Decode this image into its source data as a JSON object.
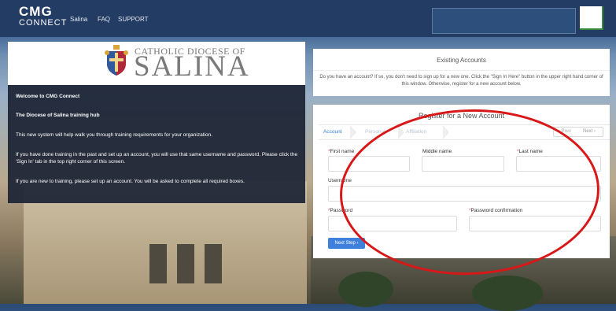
{
  "app": {
    "logo_line1": "CMG",
    "logo_line2": "CONNECT",
    "nav": [
      "Salina",
      "FAQ",
      "SUPPORT"
    ]
  },
  "diocese": {
    "line1": "CATHOLIC DIOCESE OF",
    "line2": "SALINA"
  },
  "welcome": {
    "title": "Welcome to CMG Connect",
    "hub": "The Diocese of Salina training hub",
    "p1": "This new system will help walk you through training requirements for your organization.",
    "p2": "If you have done training in the past and set up an account, you will use that same username and password.  Please click the 'Sign In' tab in the top right corner of this screen.",
    "p3": "If you are new to training, please set up an account.  You will be asked to complete all required boxes."
  },
  "existing": {
    "title": "Existing Accounts",
    "body": "Do you have an account? If so, you don't need to sign up for a new one. Click the \"Sign In Here\" button in the upper right hand corner of this window. Otherwise, register for a new account below."
  },
  "register": {
    "title": "Register for a New Account",
    "steps": [
      "Account",
      "Personal",
      "Affiliation"
    ],
    "pager_prev": "‹ Prev",
    "pager_next": "Next ›",
    "first_name": "First name",
    "middle_name": "Middle name",
    "last_name": "Last name",
    "username": "Username",
    "password": "Password",
    "password_confirmation": "Password confirmation",
    "required_mark": "*",
    "next_step": "Next Step ›"
  },
  "colors": {
    "topbar": "#233c63",
    "accent": "#3f80dd",
    "annotation": "#d81818"
  }
}
